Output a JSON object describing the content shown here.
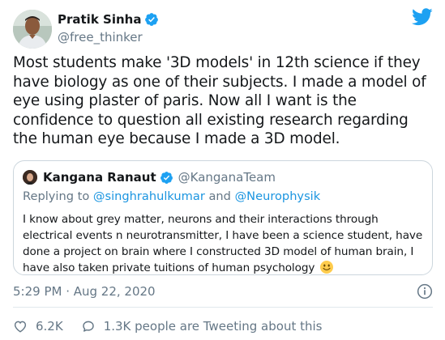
{
  "author": {
    "display_name": "Pratik Sinha",
    "handle": "@free_thinker"
  },
  "tweet": {
    "text": "Most students make '3D models' in 12th science if they have biology as one of their subjects. I made a model of eye using plaster of paris. Now all I want is the confidence to question all existing research regarding the human eye because I made a 3D model."
  },
  "quoted": {
    "display_name": "Kangana Ranaut",
    "handle": "@KanganaTeam",
    "replying_prefix": "Replying to ",
    "mention_1": "@singhrahulkumar",
    "replying_and": " and ",
    "mention_2": "@Neurophysik",
    "text": "I know about grey matter, neurons and their interactions through electrical events n neurotransmitter, I have been a science student, have done a project on brain where I constructed 3D model of human brain, I have also taken private tuitions of human psychology"
  },
  "meta": {
    "timestamp": "5:29 PM · Aug 22, 2020"
  },
  "actions": {
    "likes": "6.2K",
    "retweets": "1.3K people are Tweeting about this"
  },
  "colors": {
    "brand_blue": "#1da1f2",
    "like_red": "#e0245e",
    "secondary_text": "#657786",
    "border": "#ccd6dd"
  },
  "icons": {
    "brand": "twitter-bird-icon",
    "verified": "verified-badge-icon",
    "info": "info-icon",
    "like": "heart-icon",
    "retweet": "chat-bubble-icon",
    "emoji": "smiling-face-emoji"
  }
}
